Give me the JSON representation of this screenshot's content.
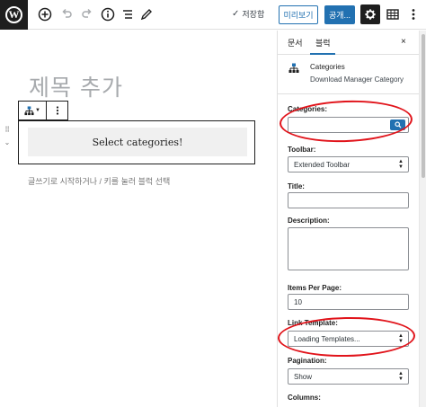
{
  "topbar": {
    "logo_letter": "W",
    "icons": [
      "add-block-icon",
      "undo-icon",
      "redo-icon",
      "info-icon",
      "list-view-icon",
      "edit-icon"
    ],
    "save_status": "저장함",
    "preview_label": "미리보기",
    "publish_label": "공개...",
    "settings_icon": "gear-icon",
    "grid_icon": "grid-icon",
    "more_icon": "more-vertical-icon"
  },
  "editor": {
    "title_placeholder": "제목 추가",
    "block_button_text": "Select categories!",
    "appender_hint": "글쓰기로 시작하거나 / 키를 눌러 블럭 선택"
  },
  "sidebar": {
    "tabs": [
      {
        "label": "문서"
      },
      {
        "label": "블럭"
      }
    ],
    "active_tab": "블럭",
    "close": "×",
    "block_card": {
      "title": "Categories",
      "description": "Download Manager Category"
    },
    "fields": {
      "categories": {
        "label": "Categories:",
        "value": ""
      },
      "toolbar": {
        "label": "Toolbar:",
        "value": "Extended Toolbar"
      },
      "title": {
        "label": "Title:",
        "value": ""
      },
      "description": {
        "label": "Description:",
        "value": ""
      },
      "items_per_page": {
        "label": "Items Per Page:",
        "value": "10"
      },
      "link_template": {
        "label": "Link Template:",
        "value": "Loading Templates..."
      },
      "pagination": {
        "label": "Pagination:",
        "value": "Show"
      },
      "columns": {
        "label": "Columns:"
      }
    }
  },
  "colors": {
    "accent": "#2271b1",
    "annotation": "#e1141b",
    "dark": "#1e1e1e"
  }
}
